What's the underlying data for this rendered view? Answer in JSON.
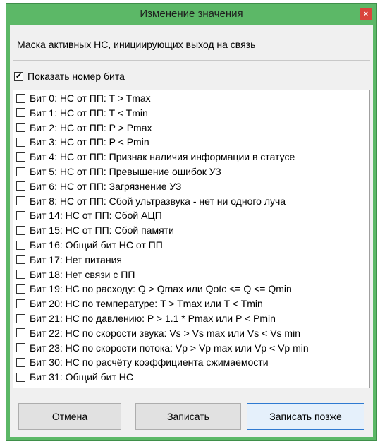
{
  "window": {
    "title": "Изменение значения",
    "close_glyph": "×"
  },
  "mask_label": "Маска активных НС, инициирующих выход на связь",
  "show_bit_number": {
    "label": "Показать номер бита",
    "checked": true
  },
  "bits": [
    {
      "label": "Бит 0: НС от ПП: T > Tmax",
      "checked": false
    },
    {
      "label": "Бит 1: НС от ПП: T < Tmin",
      "checked": false
    },
    {
      "label": "Бит 2: НС от ПП: P > Pmax",
      "checked": false
    },
    {
      "label": "Бит 3: НС от ПП: P < Pmin",
      "checked": false
    },
    {
      "label": "Бит 4: НС от ПП: Признак наличия информации в статусе",
      "checked": false
    },
    {
      "label": "Бит 5: НС от ПП: Превышение ошибок УЗ",
      "checked": false
    },
    {
      "label": "Бит 6: НС от ПП: Загрязнение УЗ",
      "checked": false
    },
    {
      "label": "Бит 8: НС от ПП: Сбой ультразвука - нет ни одного луча",
      "checked": false
    },
    {
      "label": "Бит 14: НС от ПП: Сбой АЦП",
      "checked": false
    },
    {
      "label": "Бит 15: НС от ПП: Сбой памяти",
      "checked": false
    },
    {
      "label": "Бит 16: Общий бит НС от ПП",
      "checked": false
    },
    {
      "label": "Бит 17: Нет питания",
      "checked": false
    },
    {
      "label": "Бит 18: Нет связи с ПП",
      "checked": false
    },
    {
      "label": "Бит 19: НС по расходу: Q > Qmax или Qotc <= Q <= Qmin",
      "checked": false
    },
    {
      "label": "Бит 20: НС по температуре: T > Tmax или T < Tmin",
      "checked": false
    },
    {
      "label": "Бит 21: НС по давлению: P > 1.1 * Pmax или P < Pmin",
      "checked": false
    },
    {
      "label": "Бит 22: НС по скорости звука: Vs > Vs max или Vs < Vs min",
      "checked": false
    },
    {
      "label": "Бит 23: НС по скорости потока: Vp > Vp max или Vp < Vp min",
      "checked": false
    },
    {
      "label": "Бит 30: НС по расчёту коэффициента сжимаемости",
      "checked": false
    },
    {
      "label": "Бит 31: Общий бит НС",
      "checked": false
    }
  ],
  "buttons": {
    "cancel": "Отмена",
    "write": "Записать",
    "write_later": "Записать позже"
  },
  "colors": {
    "title_bar": "#5cb867",
    "close_button": "#d9453c",
    "client_bg": "#f0f0f0"
  }
}
